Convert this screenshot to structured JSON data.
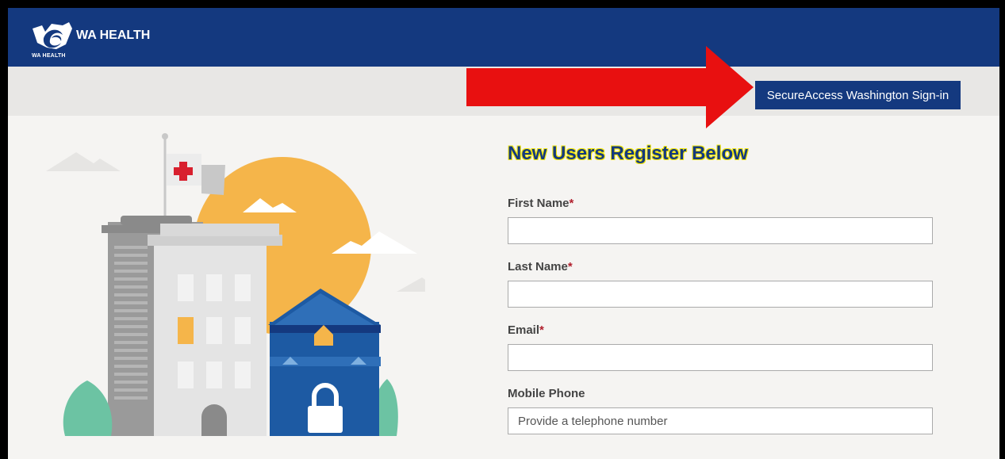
{
  "header": {
    "brand_title": "WA HEALTH",
    "brand_sub": "WA HEALTH"
  },
  "subbar": {
    "signin_label": "SecureAccess Washington Sign-in"
  },
  "form": {
    "heading": "New Users Register Below",
    "fields": [
      {
        "label": "First Name",
        "required": "*",
        "value": "",
        "placeholder": ""
      },
      {
        "label": "Last Name",
        "required": "*",
        "value": "",
        "placeholder": ""
      },
      {
        "label": "Email",
        "required": "*",
        "value": "",
        "placeholder": ""
      },
      {
        "label": "Mobile Phone",
        "required": "",
        "value": "",
        "placeholder": "Provide a telephone number"
      }
    ]
  },
  "colors": {
    "header_bg": "#14397f",
    "arrow": "#e81010",
    "sun": "#f5b54a",
    "building_blue": "#1d5aa3"
  }
}
